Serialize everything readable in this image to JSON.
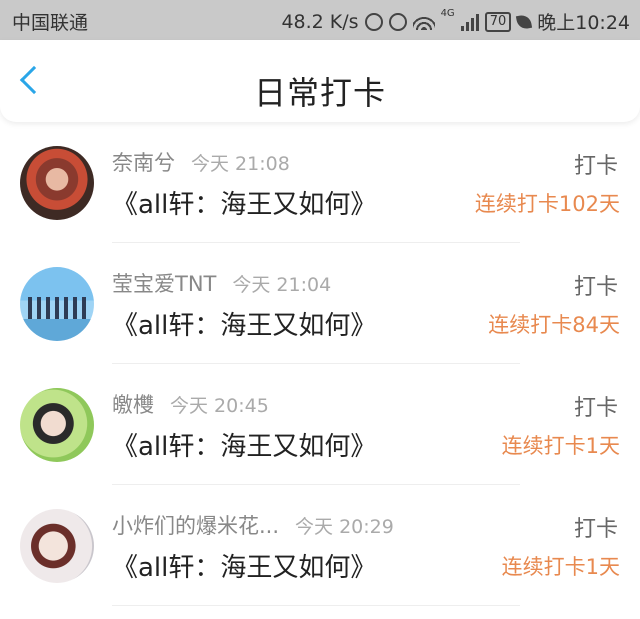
{
  "status_bar": {
    "carrier": "中国联通",
    "speed": "48.2 K/s",
    "network": "4G",
    "battery": "70",
    "time": "晚上10:24"
  },
  "header": {
    "title": "日常打卡",
    "back_icon": "chevron-left-icon",
    "accent_color": "#2aa6e8"
  },
  "streak_color": "#e8894f",
  "checkins": [
    {
      "name": "奈南兮",
      "time": "今天 21:08",
      "content": "《all轩：海王又如何》",
      "action": "打卡",
      "streak": "连续打卡102天"
    },
    {
      "name": "莹宝爱TNT",
      "time": "今天 21:04",
      "content": "《all轩：海王又如何》",
      "action": "打卡",
      "streak": "连续打卡84天"
    },
    {
      "name": "皦欆",
      "time": "今天 20:45",
      "content": "《all轩：海王又如何》",
      "action": "打卡",
      "streak": "连续打卡1天"
    },
    {
      "name": "小炸们的爆米花...",
      "time": "今天 20:29",
      "content": "《all轩：海王又如何》",
      "action": "打卡",
      "streak": "连续打卡1天"
    }
  ]
}
